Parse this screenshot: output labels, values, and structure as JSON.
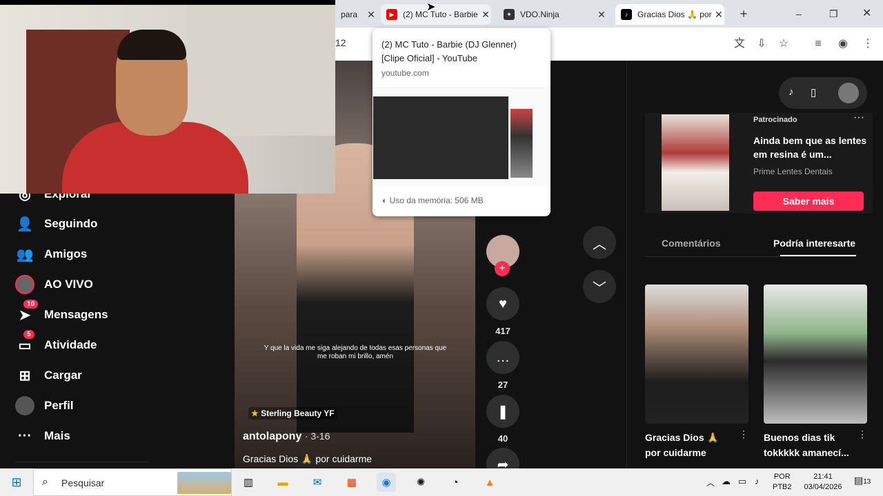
{
  "browser": {
    "tabs": [
      {
        "title": "para",
        "favicon": "none",
        "state": "inactive"
      },
      {
        "title": "(2) MC Tuto - Barbie (DJ Glenner) [Clipe Oficial] - YouTube",
        "favicon": "youtube-icon",
        "state": "hover"
      },
      {
        "title": "VDO.Ninja",
        "favicon": "vdo-ninja-icon",
        "state": "inactive"
      },
      {
        "title": "Gracias Dios 🙏 por cuidarme",
        "favicon": "tiktok-icon",
        "state": "active"
      }
    ],
    "new_tab": "+",
    "address_fragment": "12",
    "window_controls": [
      "–",
      "❐",
      "✕"
    ]
  },
  "tooltip": {
    "title": "(2) MC Tuto - Barbie (DJ Glenner) [Clipe Oficial] - YouTube",
    "domain": "youtube.com",
    "memory": "Uso da memória: 506 MB"
  },
  "sidebar": {
    "items": [
      {
        "label": "Explorar",
        "icon": "compass-icon"
      },
      {
        "label": "Seguindo",
        "icon": "following-icon"
      },
      {
        "label": "Amigos",
        "icon": "friends-icon"
      },
      {
        "label": "AO VIVO",
        "icon": "live-icon"
      },
      {
        "label": "Mensagens",
        "icon": "messages-icon",
        "badge": "10"
      },
      {
        "label": "Atividade",
        "icon": "activity-icon",
        "badge": "5"
      },
      {
        "label": "Cargar",
        "icon": "upload-icon"
      },
      {
        "label": "Perfil",
        "icon": "profile-icon"
      },
      {
        "label": "Mais",
        "icon": "more-icon"
      }
    ]
  },
  "video": {
    "caption": "Y que la vida me siga alejando de todas esas personas que me roban mi brillo, amén",
    "sticker": "Sterling Beauty YF",
    "author": "antolapony",
    "date": "· 3-16",
    "description": "Gracias Dios 🙏 por cuidarme"
  },
  "actions": {
    "likes": "417",
    "comments": "27",
    "saves": "40"
  },
  "ad": {
    "label": "Patrocinado",
    "title": "Ainda bem que as lentes em resina é um...",
    "advertiser": "Prime Lentes Dentais",
    "cta": "Saber mais"
  },
  "panel_tabs": [
    "Comentários",
    "Podría interesarte"
  ],
  "recommendations": [
    {
      "title": "Gracias Dios 🙏 por cuidarme"
    },
    {
      "title": "Buenos dias tik tokkkkk amanecí..."
    }
  ],
  "taskbar": {
    "search_placeholder": "Pesquisar",
    "lang": "POR",
    "layout": "PTB2",
    "time": "21:41",
    "date": "03/04/2026",
    "notifications": "13"
  },
  "colors": {
    "accent": "#fe2c55",
    "background": "#121212"
  }
}
